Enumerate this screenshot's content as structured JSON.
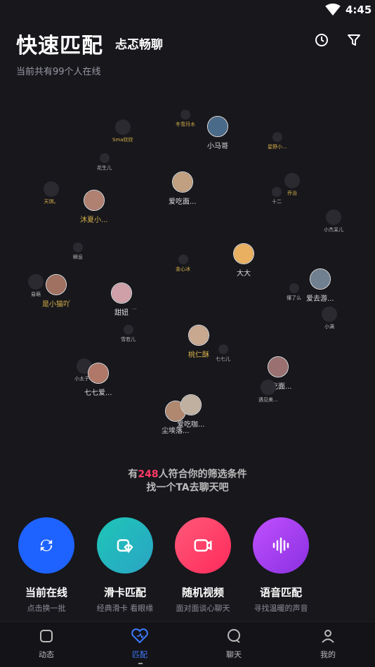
{
  "status": {
    "time": "4:45"
  },
  "header": {
    "title": "快速匹配",
    "brand": "忐忑畅聊",
    "online_text": "当前共有99个人在线"
  },
  "nodes": [
    {
      "label": "Sma欣欣",
      "kind": "mid",
      "color": "y"
    },
    {
      "label": "冬雪月水",
      "kind": "small",
      "color": "y"
    },
    {
      "label": "小马哥",
      "kind": "big",
      "color": "w"
    },
    {
      "label": "星野小...",
      "kind": "small",
      "color": "y"
    },
    {
      "label": "花生儿",
      "kind": "small",
      "color": "w"
    },
    {
      "label": "爱吃面...",
      "kind": "big",
      "color": "w"
    },
    {
      "label": "乔治",
      "kind": "mid",
      "color": "y"
    },
    {
      "label": "十二",
      "kind": "small",
      "color": "w"
    },
    {
      "label": "天琪。",
      "kind": "mid",
      "color": "y"
    },
    {
      "label": "沐夏小...",
      "kind": "big",
      "color": "y"
    },
    {
      "label": "小杰呆儿",
      "kind": "mid",
      "color": "w"
    },
    {
      "label": "瞬息",
      "kind": "small",
      "color": "w"
    },
    {
      "label": "金心冰",
      "kind": "small",
      "color": "y"
    },
    {
      "label": "大大",
      "kind": "big",
      "color": "w"
    },
    {
      "label": "易萌",
      "kind": "mid",
      "color": "w"
    },
    {
      "label": "是小猫吖",
      "kind": "big",
      "color": "y"
    },
    {
      "label": "甜妞",
      "kind": "big",
      "color": "w"
    },
    {
      "label": "...",
      "kind": "small",
      "color": "w"
    },
    {
      "label": "爱去游...",
      "kind": "big",
      "color": "w"
    },
    {
      "label": "懂了么",
      "kind": "small",
      "color": "w"
    },
    {
      "label": "小满",
      "kind": "mid",
      "color": "w"
    },
    {
      "label": "雪若儿",
      "kind": "small",
      "color": "w"
    },
    {
      "label": "桃仁酥",
      "kind": "big",
      "color": "y"
    },
    {
      "label": "七七儿",
      "kind": "small",
      "color": "w"
    },
    {
      "label": "小太子呀",
      "kind": "mid",
      "color": "w"
    },
    {
      "label": "七七爱...",
      "kind": "big",
      "color": "w"
    },
    {
      "label": "爱吃面...",
      "kind": "big",
      "color": "w"
    },
    {
      "label": "遇见美...",
      "kind": "mid",
      "color": "w"
    },
    {
      "label": "尘埃落...",
      "kind": "big",
      "color": "w"
    },
    {
      "label": "爱吃咖...",
      "kind": "big",
      "color": "w"
    }
  ],
  "match": {
    "prefix": "有",
    "count": "248",
    "suffix": "人符合你的筛选条件",
    "line2": "找一个TA去聊天吧"
  },
  "features": [
    {
      "name": "当前在线",
      "desc": "点击换一批",
      "color": "#1e63ff"
    },
    {
      "name": "滑卡匹配",
      "desc": "经典滑卡 看眼缘",
      "color": "#1ec6b6"
    },
    {
      "name": "随机视频",
      "desc": "面对面谈心聊天",
      "color": "#ff3a66"
    },
    {
      "name": "语音匹配",
      "desc": "寻找温暖的声音",
      "color": "#b040ff"
    }
  ],
  "tabs": [
    {
      "label": "动态",
      "icon": "square-icon"
    },
    {
      "label": "匹配",
      "icon": "heart-icon"
    },
    {
      "label": "聊天",
      "icon": "chat-icon"
    },
    {
      "label": "我的",
      "icon": "person-icon"
    }
  ],
  "colors": {
    "accent": "#3d7bff",
    "highlight": "#ff3a66"
  }
}
